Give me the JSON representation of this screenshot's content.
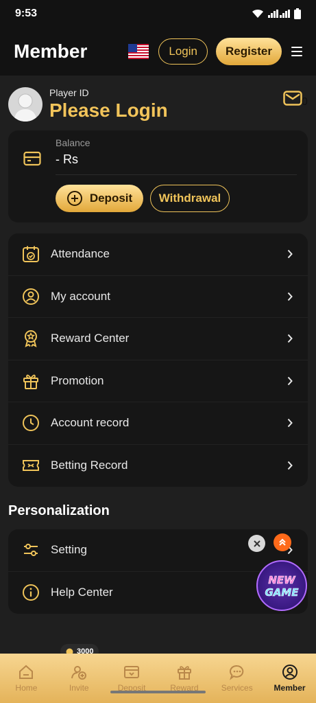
{
  "status": {
    "time": "9:53"
  },
  "header": {
    "title": "Member",
    "login_label": "Login",
    "register_label": "Register"
  },
  "profile": {
    "player_id_label": "Player ID",
    "login_prompt": "Please Login",
    "unread_count": "0"
  },
  "balance": {
    "label": "Balance",
    "value": "- Rs",
    "deposit_label": "Deposit",
    "withdrawal_label": "Withdrawal"
  },
  "menu": {
    "items": [
      {
        "label": "Attendance"
      },
      {
        "label": "My account"
      },
      {
        "label": "Reward Center"
      },
      {
        "label": "Promotion"
      },
      {
        "label": "Account record"
      },
      {
        "label": "Betting Record"
      }
    ]
  },
  "personalization": {
    "title": "Personalization",
    "items": [
      {
        "label": "Setting"
      },
      {
        "label": "Help Center"
      }
    ]
  },
  "invite_badge": "3000",
  "promo": {
    "new_game_text": "NEW GAME"
  },
  "bottom_nav": [
    {
      "label": "Home"
    },
    {
      "label": "Invite"
    },
    {
      "label": "Deposit"
    },
    {
      "label": "Reward"
    },
    {
      "label": "Services"
    },
    {
      "label": "Member"
    }
  ],
  "colors": {
    "accent": "#f0c45a",
    "background": "#1f1f1f",
    "card": "#161616",
    "nav": "#f2cd83"
  }
}
